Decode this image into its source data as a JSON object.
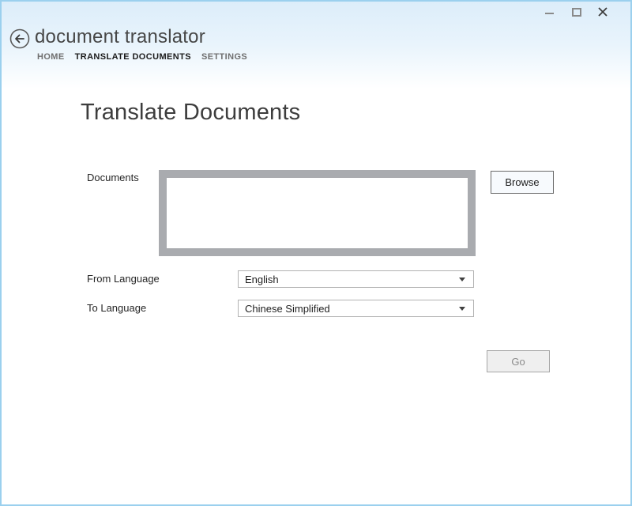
{
  "window": {
    "border_color": "#9bd0ee",
    "bg_top_color": "#dcedfa",
    "controls": {
      "minimize": "minimize",
      "maximize": "maximize",
      "close": "close"
    }
  },
  "header": {
    "title": "document translator",
    "back_icon": "back-arrow-icon",
    "nav": [
      {
        "label": "HOME",
        "active": false
      },
      {
        "label": "TRANSLATE DOCUMENTS",
        "active": true
      },
      {
        "label": "SETTINGS",
        "active": false
      }
    ]
  },
  "main": {
    "heading": "Translate Documents",
    "documents_label": "Documents",
    "documents_list_items": [],
    "documents_listbox_border_color": "#a9abaf",
    "browse_label": "Browse",
    "from_language_label": "From Language",
    "from_language_value": "English",
    "to_language_label": "To Language",
    "to_language_value": "Chinese Simplified",
    "go_label": "Go",
    "go_enabled": false
  },
  "icons": {
    "back": "back-arrow-icon",
    "minimize": "minimize-icon",
    "maximize": "maximize-icon",
    "close": "close-icon",
    "dropdown": "chevron-down-icon"
  }
}
